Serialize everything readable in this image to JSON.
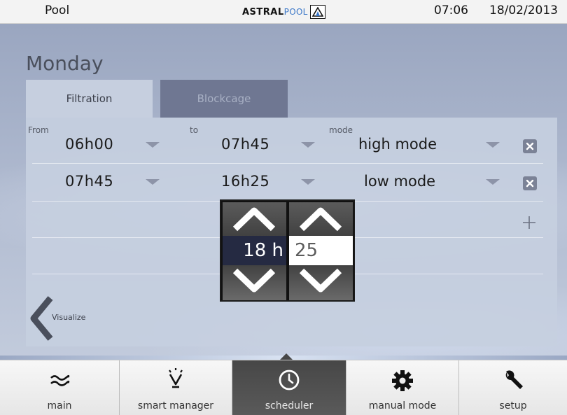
{
  "topbar": {
    "app_title": "Pool",
    "brand_strong": "ASTRAL",
    "brand_light": "POOL",
    "time": "07:06",
    "date": "18/02/2013"
  },
  "day": "Monday",
  "tabs": [
    {
      "label": "Filtration",
      "active": true
    },
    {
      "label": "Blockcage",
      "active": false
    }
  ],
  "columns": {
    "from": "From",
    "to": "to",
    "mode": "mode"
  },
  "rows": [
    {
      "from": "06h00",
      "to": "07h45",
      "mode": "high mode"
    },
    {
      "from": "07h45",
      "to": "16h25",
      "mode": "low mode"
    }
  ],
  "visualize_label": "Visualize",
  "picker": {
    "hour": "18 h",
    "minute": "25"
  },
  "nav": [
    {
      "label": "main",
      "icon": "waves-icon",
      "active": false
    },
    {
      "label": "smart manager",
      "icon": "lightbulb-icon",
      "active": false
    },
    {
      "label": "scheduler",
      "icon": "clock-icon",
      "active": true
    },
    {
      "label": "manual mode",
      "icon": "gear-icon",
      "active": false
    },
    {
      "label": "setup",
      "icon": "wrench-icon",
      "active": false
    }
  ],
  "colors": {
    "accent_dark": "#252a42",
    "panel": "#c6cfdf",
    "inactive_tab": "#6f7792"
  }
}
